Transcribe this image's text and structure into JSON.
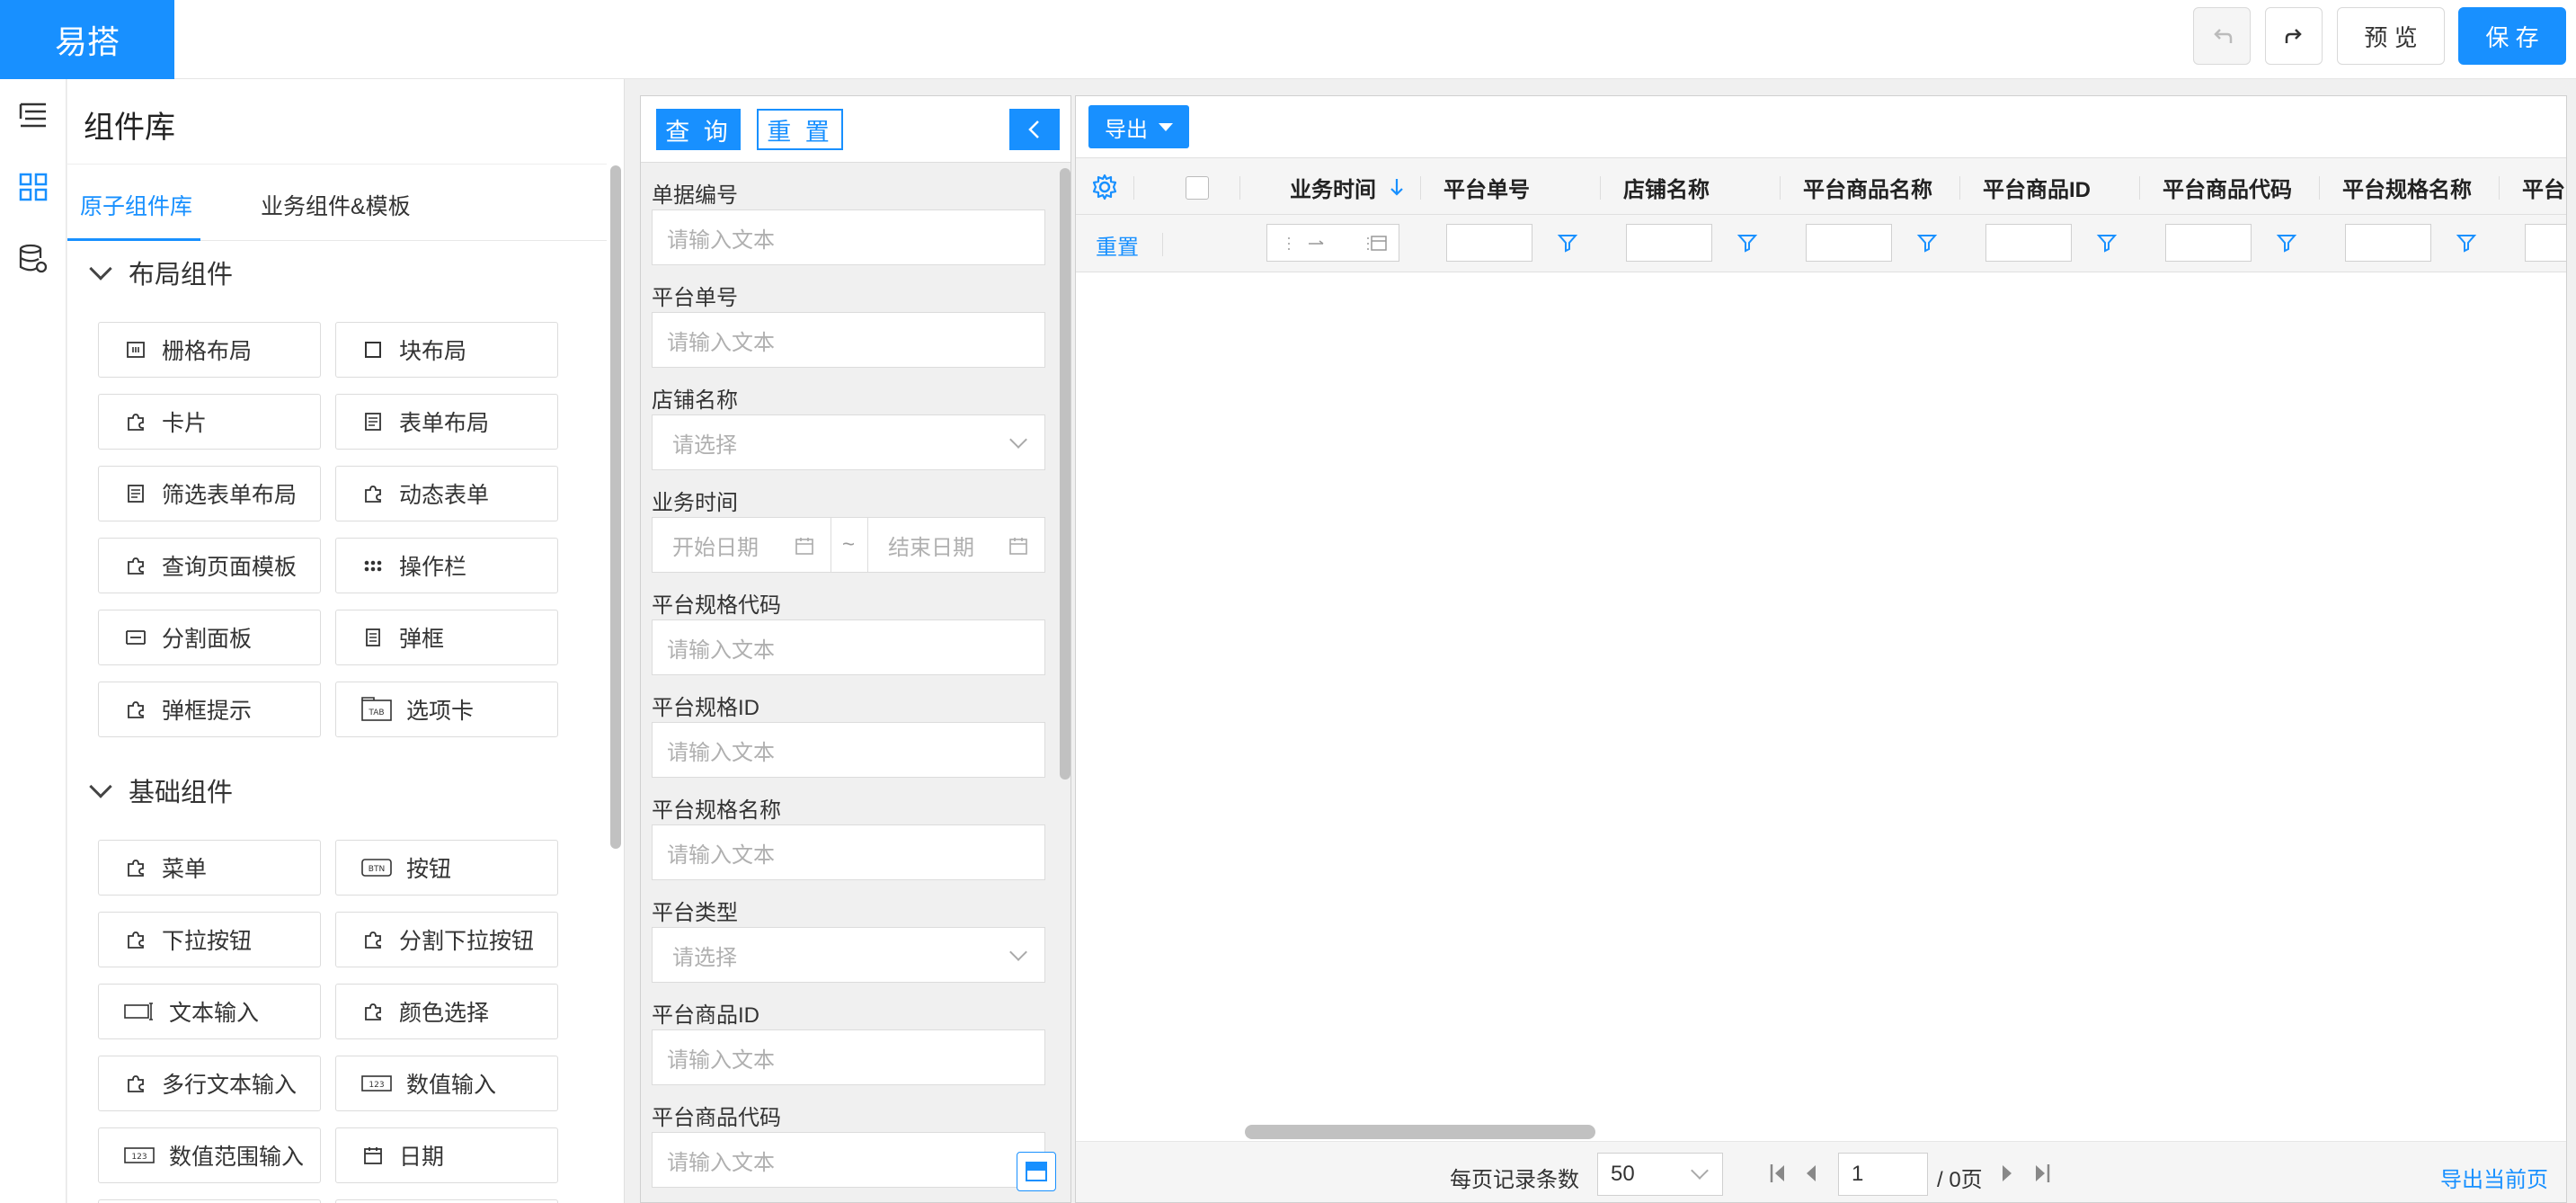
{
  "app": {
    "logo": "易搭"
  },
  "toolbar": {
    "preview_label": "预 览",
    "save_label": "保 存"
  },
  "library": {
    "title": "组件库",
    "tabs": [
      "原子组件库",
      "业务组件&模板"
    ],
    "sections": [
      {
        "title": "布局组件",
        "items": [
          {
            "label": "栅格布局",
            "icon": "grid-layout-icon"
          },
          {
            "label": "块布局",
            "icon": "block-layout-icon"
          },
          {
            "label": "卡片",
            "icon": "puzzle-icon"
          },
          {
            "label": "表单布局",
            "icon": "form-layout-icon"
          },
          {
            "label": "筛选表单布局",
            "icon": "form-layout-icon"
          },
          {
            "label": "动态表单",
            "icon": "puzzle-icon"
          },
          {
            "label": "查询页面模板",
            "icon": "puzzle-icon"
          },
          {
            "label": "操作栏",
            "icon": "dots-icon"
          },
          {
            "label": "分割面板",
            "icon": "split-panel-icon"
          },
          {
            "label": "弹框",
            "icon": "dialog-icon"
          },
          {
            "label": "弹框提示",
            "icon": "puzzle-icon"
          },
          {
            "label": "选项卡",
            "icon": "tab-icon"
          }
        ]
      },
      {
        "title": "基础组件",
        "items": [
          {
            "label": "菜单",
            "icon": "puzzle-icon"
          },
          {
            "label": "按钮",
            "icon": "button-icon"
          },
          {
            "label": "下拉按钮",
            "icon": "puzzle-icon"
          },
          {
            "label": "分割下拉按钮",
            "icon": "puzzle-icon"
          },
          {
            "label": "文本输入",
            "icon": "text-input-icon"
          },
          {
            "label": "颜色选择",
            "icon": "puzzle-icon"
          },
          {
            "label": "多行文本输入",
            "icon": "puzzle-icon"
          },
          {
            "label": "数值输入",
            "icon": "number-input-icon"
          },
          {
            "label": "数值范围输入",
            "icon": "number-input-icon"
          },
          {
            "label": "日期",
            "icon": "calendar-icon"
          }
        ]
      }
    ],
    "icon_text": {
      "tab": "TAB",
      "button": "BTN",
      "number": "123"
    }
  },
  "query": {
    "search_label": "查 询",
    "reset_label": "重 置",
    "fields": [
      {
        "label": "单据编号",
        "type": "text",
        "placeholder": "请输入文本"
      },
      {
        "label": "平台单号",
        "type": "text",
        "placeholder": "请输入文本"
      },
      {
        "label": "店铺名称",
        "type": "select",
        "placeholder": "请选择"
      },
      {
        "label": "业务时间",
        "type": "daterange",
        "start": "开始日期",
        "end": "结束日期",
        "sep": "~"
      },
      {
        "label": "平台规格代码",
        "type": "text",
        "placeholder": "请输入文本"
      },
      {
        "label": "平台规格ID",
        "type": "text",
        "placeholder": "请输入文本"
      },
      {
        "label": "平台规格名称",
        "type": "text",
        "placeholder": "请输入文本"
      },
      {
        "label": "平台类型",
        "type": "select",
        "placeholder": "请选择"
      },
      {
        "label": "平台商品ID",
        "type": "text",
        "placeholder": "请输入文本"
      },
      {
        "label": "平台商品代码",
        "type": "text",
        "placeholder": "请输入文本"
      }
    ]
  },
  "grid": {
    "export_label": "导出",
    "reset_label": "重置",
    "columns": [
      "业务时间",
      "平台单号",
      "店铺名称",
      "平台商品名称",
      "平台商品ID",
      "平台商品代码",
      "平台规格名称",
      "平台"
    ],
    "footer": {
      "page_size_label": "每页记录条数",
      "page_size": "50",
      "page_input": "1",
      "page_total": "/ 0页",
      "export_current": "导出当前页"
    }
  },
  "colors": {
    "accent": "#1890ff"
  }
}
